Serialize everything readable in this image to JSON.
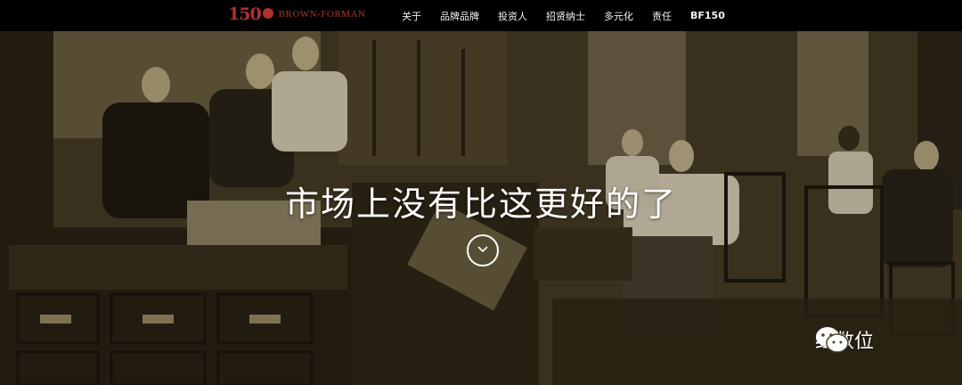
{
  "logo": {
    "number": "150",
    "text": "BROWN-FORMAN"
  },
  "nav": {
    "items": [
      {
        "label": "关于"
      },
      {
        "label": "品牌品牌"
      },
      {
        "label": "投资人"
      },
      {
        "label": "招贤纳士"
      },
      {
        "label": "多元化"
      },
      {
        "label": "责任"
      },
      {
        "label": "BF150"
      }
    ]
  },
  "hero": {
    "headline": "市场上没有比这更好的了"
  },
  "watermark": {
    "text": "红数位"
  },
  "colors": {
    "brand": "#b0322e",
    "nav_bg": "#000000",
    "sepia": "#4c4229"
  }
}
